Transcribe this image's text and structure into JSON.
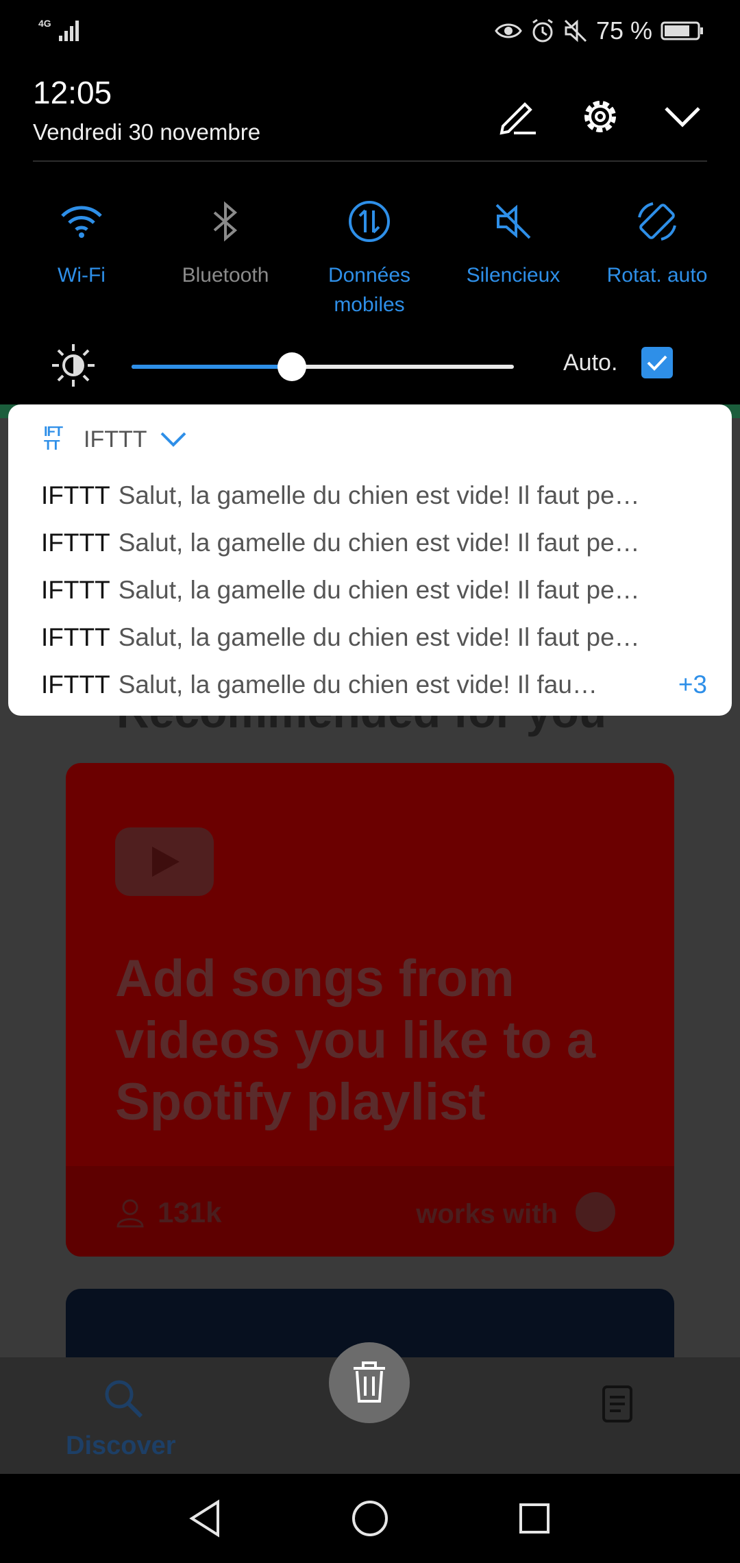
{
  "status_bar": {
    "network": "4G",
    "battery_percent": "75 %",
    "icons": [
      "eye-comfort-icon",
      "alarm-icon",
      "mute-icon",
      "battery-icon"
    ]
  },
  "shade": {
    "time": "12:05",
    "date": "Vendredi 30 novembre",
    "header_icons": [
      "edit-icon",
      "settings-gear-icon",
      "collapse-chevron-icon"
    ],
    "tiles": [
      {
        "label": "Wi-Fi",
        "icon": "wifi-icon",
        "active": true
      },
      {
        "label": "Bluetooth",
        "icon": "bluetooth-icon",
        "active": false
      },
      {
        "label": "Données mobiles",
        "icon": "mobile-data-icon",
        "active": true
      },
      {
        "label": "Silencieux",
        "icon": "silent-icon",
        "active": true
      },
      {
        "label": "Rotat. auto",
        "icon": "auto-rotate-icon",
        "active": true
      }
    ],
    "brightness": {
      "level": 0.42,
      "auto_label": "Auto.",
      "auto_checked": true
    }
  },
  "notification": {
    "app_name": "IFTTT",
    "lines": [
      {
        "sender": "IFTTT",
        "text": "Salut, la gamelle du chien est vide! Il faut pe…"
      },
      {
        "sender": "IFTTT",
        "text": "Salut, la gamelle du chien est vide! Il faut pe…"
      },
      {
        "sender": "IFTTT",
        "text": "Salut, la gamelle du chien est vide! Il faut pe…"
      },
      {
        "sender": "IFTTT",
        "text": "Salut, la gamelle du chien est vide! Il faut pe…"
      },
      {
        "sender": "IFTTT",
        "text": "Salut, la gamelle du chien est vide! Il fau…"
      }
    ],
    "more_count": "+3"
  },
  "background_app": {
    "heading": "Recommended for you",
    "card": {
      "title": "Add songs from videos you like to a Spotify playlist",
      "users": "131k",
      "works_with": "works with"
    },
    "nav": {
      "discover_label": "Discover"
    }
  },
  "colors": {
    "accent": "#2e8fe8",
    "shade_bg": "#000000",
    "card_red": "#6b0000"
  }
}
